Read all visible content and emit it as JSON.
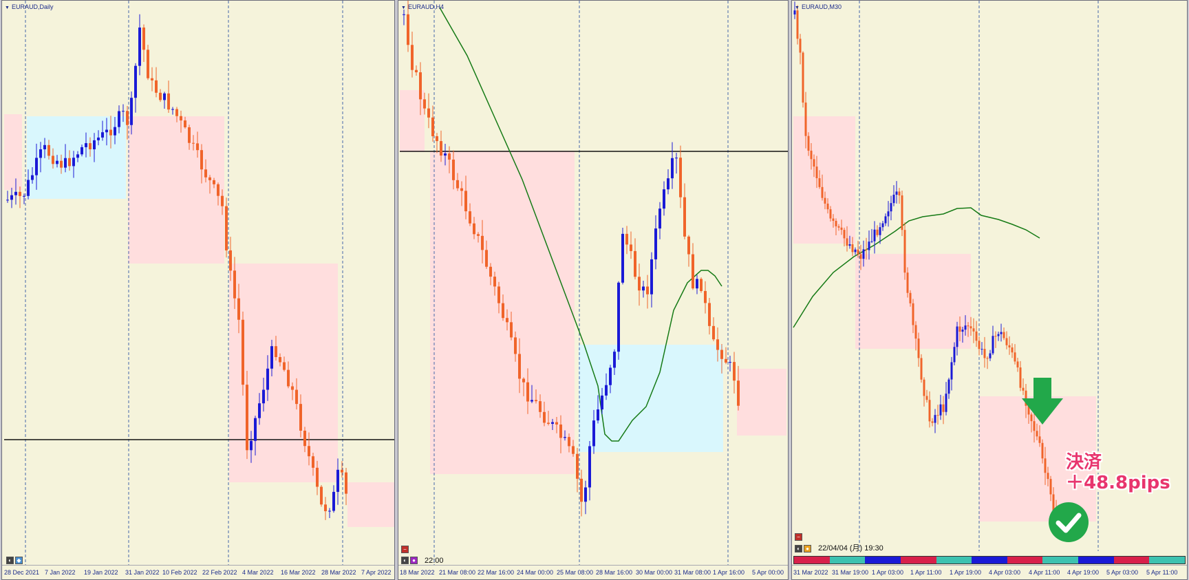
{
  "panels": [
    {
      "symbol": "EURAUD,Daily",
      "time_labels": [
        "28 Dec 2021",
        "7 Jan 2022",
        "19 Jan 2022",
        "31 Jan 2022",
        "10 Feb 2022",
        "22 Feb 2022",
        "4 Mar 2022",
        "16 Mar 2022",
        "28 Mar 2022",
        "7 Apr 2022"
      ]
    },
    {
      "symbol": "EURAUD,H4",
      "time_labels": [
        "18 Mar 2022",
        "21 Mar 08:00",
        "22 Mar 16:00",
        "24 Mar 00:00",
        "25 Mar 08:00",
        "28 Mar 16:00",
        "30 Mar 00:00",
        "31 Mar 08:00",
        "1 Apr 16:00",
        "5 Apr 00:00"
      ],
      "clock_label": "22:00"
    },
    {
      "symbol": "EURAUD,M30",
      "time_labels": [
        "31 Mar 2022",
        "31 Mar 19:00",
        "1 Apr 03:00",
        "1 Apr 11:00",
        "1 Apr 19:00",
        "4 Apr 03:00",
        "4 Apr 11:00",
        "4 Apr 19:00",
        "5 Apr 03:00",
        "5 Apr 11:00"
      ],
      "datetime_label": "22/04/04 (月) 19:30"
    }
  ],
  "annotation": {
    "line1": "決済",
    "line2": "＋48.8pips"
  },
  "icons": [
    "down-arrow-icon",
    "check-circle-icon"
  ],
  "colors": {
    "background": "#f5f3db",
    "bull_candle": "#1a1ad6",
    "bear_candle": "#f0642a",
    "ma_line": "#157a15",
    "pink_zone": "#ffd6d6",
    "blue_zone": "#d6f8ff",
    "signal_green": "#22a84a",
    "note_pink": "#e8356e"
  }
}
